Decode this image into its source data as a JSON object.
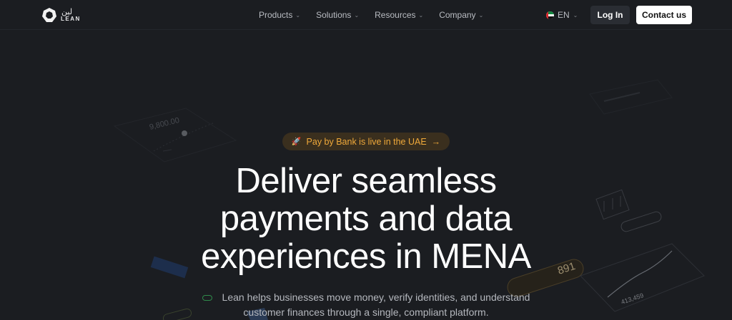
{
  "brand": {
    "name_ar": "لين",
    "name_en": "LEAN"
  },
  "nav": {
    "items": [
      {
        "label": "Products"
      },
      {
        "label": "Solutions"
      },
      {
        "label": "Resources"
      },
      {
        "label": "Company"
      }
    ]
  },
  "lang": {
    "label": "EN"
  },
  "buttons": {
    "login": "Log In",
    "contact": "Contact us"
  },
  "announcement": {
    "text": "Pay by Bank is live in the UAE",
    "arrow": "→"
  },
  "hero": {
    "headline": [
      "Deliver seamless",
      "payments and data",
      "experiences in MENA"
    ],
    "subtitle": "Lean helps businesses move money, verify identities, and understand customer finances through a single, compliant platform."
  },
  "decor": {
    "balance": "9,800.00",
    "amount_right": "891",
    "settled": "413,459"
  },
  "colors": {
    "accent": "#f0a93a",
    "background": "#1b1d21"
  }
}
